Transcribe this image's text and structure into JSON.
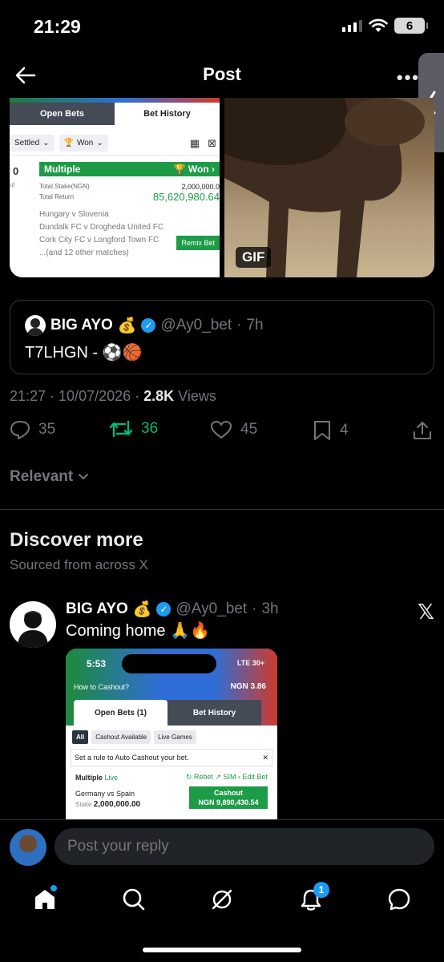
{
  "status": {
    "time": "21:29",
    "battery": "6"
  },
  "header": {
    "title": "Post"
  },
  "media": {
    "gif_label": "GIF",
    "bet_history": {
      "tab_open": "Open Bets",
      "tab_history": "Bet History",
      "filter_settled": "Settled",
      "filter_won": "Won",
      "side_number": "0",
      "side_sub": "ul",
      "multiple_label": "Multiple",
      "won_label": "Won",
      "total_stake_label": "Total Stake(NGN)",
      "total_stake_value": "2,000,000.0",
      "total_return_label": "Total Return",
      "total_return_value": "85,620,980.64",
      "matches": [
        "Hungary v Slovenia",
        "Dundalk FC v Drogheda United FC",
        "Cork City FC v Longford Town FC",
        "...(and 12 other matches)"
      ],
      "remix_label": "Remix Bet"
    }
  },
  "quote": {
    "name": "BIG AYO",
    "name_emoji": "💰",
    "handle": "@Ay0_bet",
    "time": "7h",
    "text": "T7LHGN - ⚽🏀"
  },
  "meta": {
    "timestamp": "21:27 · 10/07/2026 · ",
    "views_count": "2.8K",
    "views_label": " Views"
  },
  "actions": {
    "replies": "35",
    "reposts": "36",
    "likes": "45",
    "bookmarks": "4"
  },
  "filter": {
    "label": "Relevant"
  },
  "discover": {
    "title": "Discover more",
    "subtitle": "Sourced from across X"
  },
  "post": {
    "name": "BIG AYO",
    "name_emoji": "💰",
    "handle": "@Ay0_bet",
    "time": "3h",
    "text": "Coming home 🙏🔥",
    "screenshot": {
      "time": "5:53",
      "network": "LTE 30+",
      "how_to": "How to Cashout?",
      "balance": "NGN 3.86",
      "tab_open": "Open Bets (1)",
      "tab_history": "Bet History",
      "chip_all": "All",
      "chip_cashout": "Cashout Available",
      "chip_live": "Live Games",
      "rule_text": "Set a rule to Auto Cashout your bet.",
      "multiple": "Multiple",
      "live": "Live",
      "rebet": "Rebet",
      "sim": "SIM",
      "edit_bet": "Edit Bet",
      "match": "Germany vs Spain",
      "stake_label": "Stake",
      "stake_value": "2,000,000.00",
      "cashout_label": "Cashout",
      "cashout_value": "NGN 9,890,430.54"
    }
  },
  "reply": {
    "placeholder": "Post your reply"
  },
  "nav": {
    "notification_count": "1"
  },
  "colors": {
    "accent": "#1d9bf0",
    "repost": "#00ba7c",
    "muted": "#71767b",
    "sportybet_green": "#1e9b47"
  }
}
